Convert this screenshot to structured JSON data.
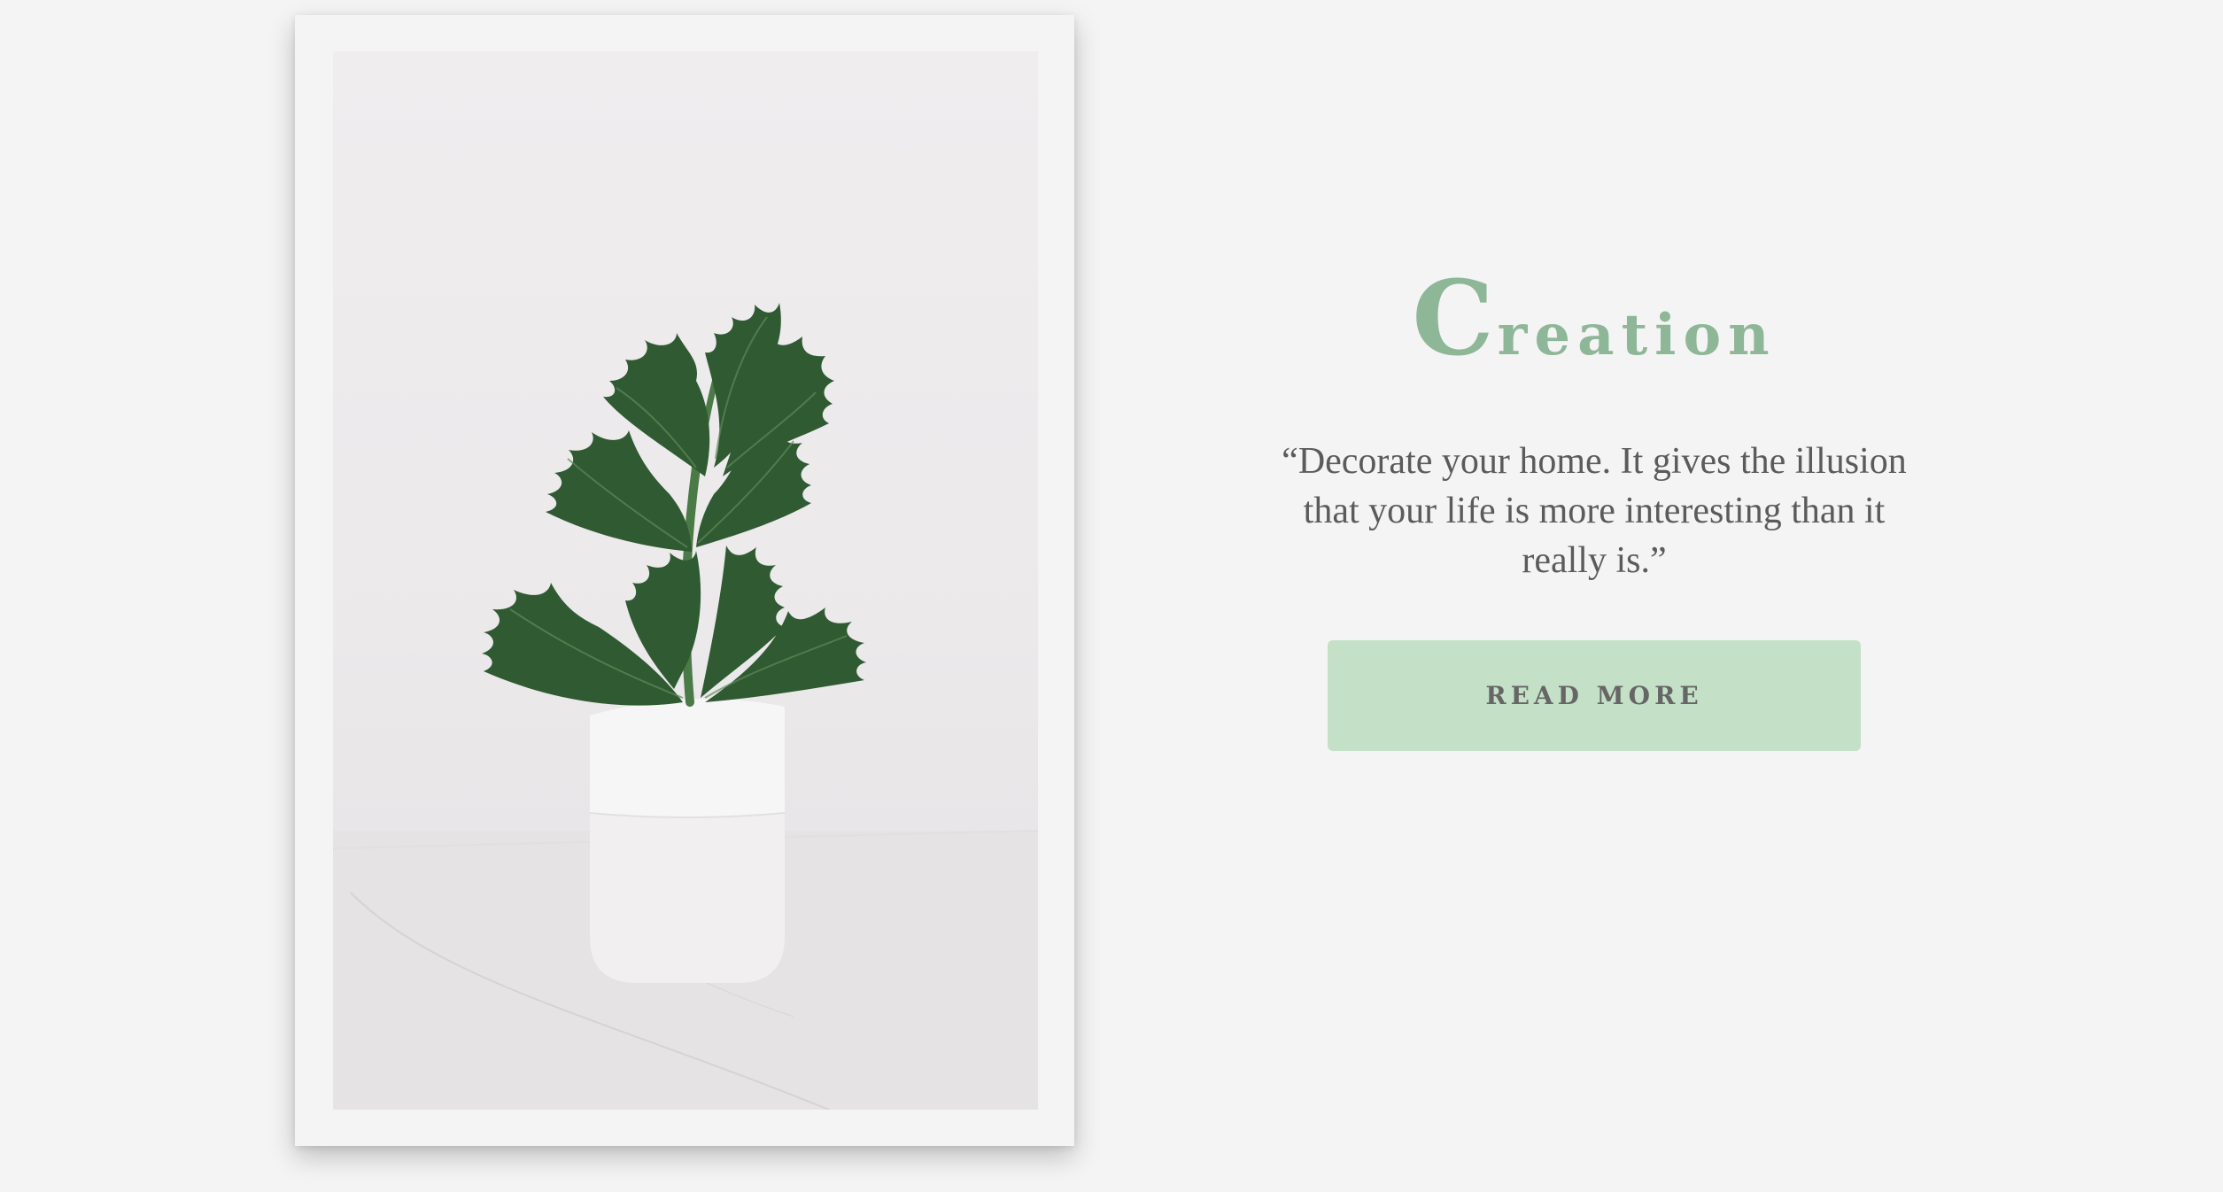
{
  "hero": {
    "title_initial": "C",
    "title_rest": "reation",
    "quote": "“Decorate your home. It gives the illusion that your life is more interesting than it really is.”",
    "button_label": "READ MORE"
  },
  "photo": {
    "icon": "plant-in-vase-photo"
  },
  "colors": {
    "background": "#f4f4f4",
    "accent": "#8db797",
    "button_bg": "#c4e1c8",
    "text": "#5b5b5b",
    "leaf": "#2f5a32"
  }
}
